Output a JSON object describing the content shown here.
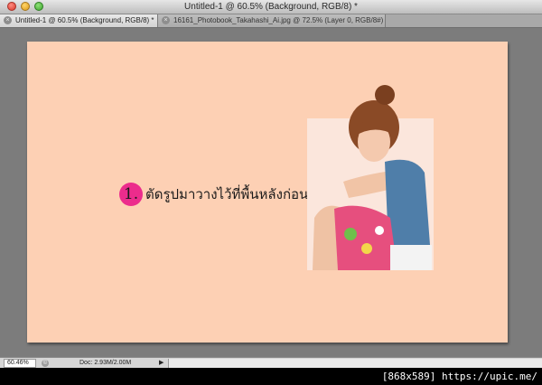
{
  "window": {
    "title": "Untitled-1 @ 60.5% (Background, RGB/8) *"
  },
  "tabs": [
    {
      "label": "Untitled-1 @ 60.5% (Background, RGB/8) *",
      "close_glyph": "×",
      "active": true
    },
    {
      "label": "16161_Photobook_Takahashi_Ai.jpg @ 72.5% (Layer 0, RGB/8#) *",
      "close_glyph": "×",
      "active": false
    }
  ],
  "canvas": {
    "background_color": "#fdd0b4",
    "step_number": "1.",
    "step_text": "ตัดรูปมาวางไว้ที่พื้นหลังก่อน",
    "step_badge_color": "#ec2c8c",
    "image_name": "photo-of-girl"
  },
  "statusbar": {
    "zoom": "60.46%",
    "doc_info": "Doc: 2.93M/2.00M",
    "arrow": "▶"
  },
  "watermark": "[868x589] https://upic.me/"
}
